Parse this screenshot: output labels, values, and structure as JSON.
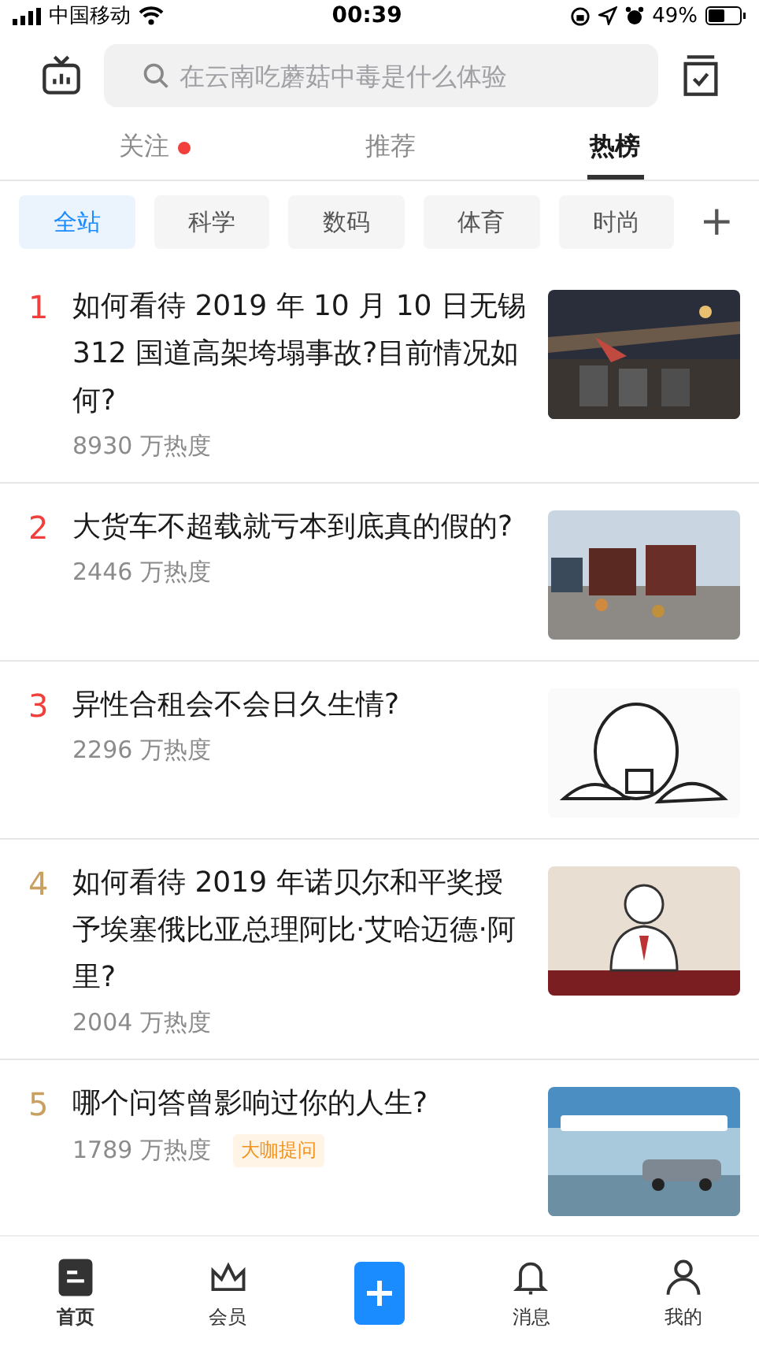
{
  "status_bar": {
    "carrier": "中国移动",
    "time": "00:39",
    "battery": "49%"
  },
  "search": {
    "placeholder": "在云南吃蘑菇中毒是什么体验"
  },
  "tabs": [
    {
      "label": "关注",
      "selected": false,
      "dot": true
    },
    {
      "label": "推荐",
      "selected": false,
      "dot": false
    },
    {
      "label": "热榜",
      "selected": true,
      "dot": false
    }
  ],
  "categories": [
    {
      "label": "全站",
      "selected": true
    },
    {
      "label": "科学",
      "selected": false
    },
    {
      "label": "数码",
      "selected": false
    },
    {
      "label": "体育",
      "selected": false
    },
    {
      "label": "时尚",
      "selected": false
    }
  ],
  "add_category": "+",
  "hot_list": [
    {
      "rank": "1",
      "color": "#f1403c",
      "title": "如何看待 2019 年 10 月 10 日无锡 312 国道高架垮塌事故?目前情况如何?",
      "heat": "8930 万热度"
    },
    {
      "rank": "2",
      "color": "#f1403c",
      "title": "大货车不超载就亏本到底真的假的?",
      "heat": "2446 万热度"
    },
    {
      "rank": "3",
      "color": "#f1403c",
      "title": "异性合租会不会日久生情?",
      "heat": "2296 万热度"
    },
    {
      "rank": "4",
      "color": "#c8a062",
      "title": "如何看待 2019 年诺贝尔和平奖授予埃塞俄比亚总理阿比·艾哈迈德·阿里?",
      "heat": "2004 万热度"
    },
    {
      "rank": "5",
      "color": "#c8a062",
      "title": "哪个问答曾影响过你的人生?",
      "heat": "1789 万热度",
      "tag": "大咖提问"
    }
  ],
  "bottom_nav": [
    {
      "kind": "home",
      "label": "首页",
      "selected": true
    },
    {
      "kind": "vip",
      "label": "会员",
      "selected": false
    },
    {
      "kind": "add"
    },
    {
      "kind": "bell",
      "label": "消息",
      "selected": false
    },
    {
      "kind": "profile",
      "label": "我的",
      "selected": false
    }
  ]
}
